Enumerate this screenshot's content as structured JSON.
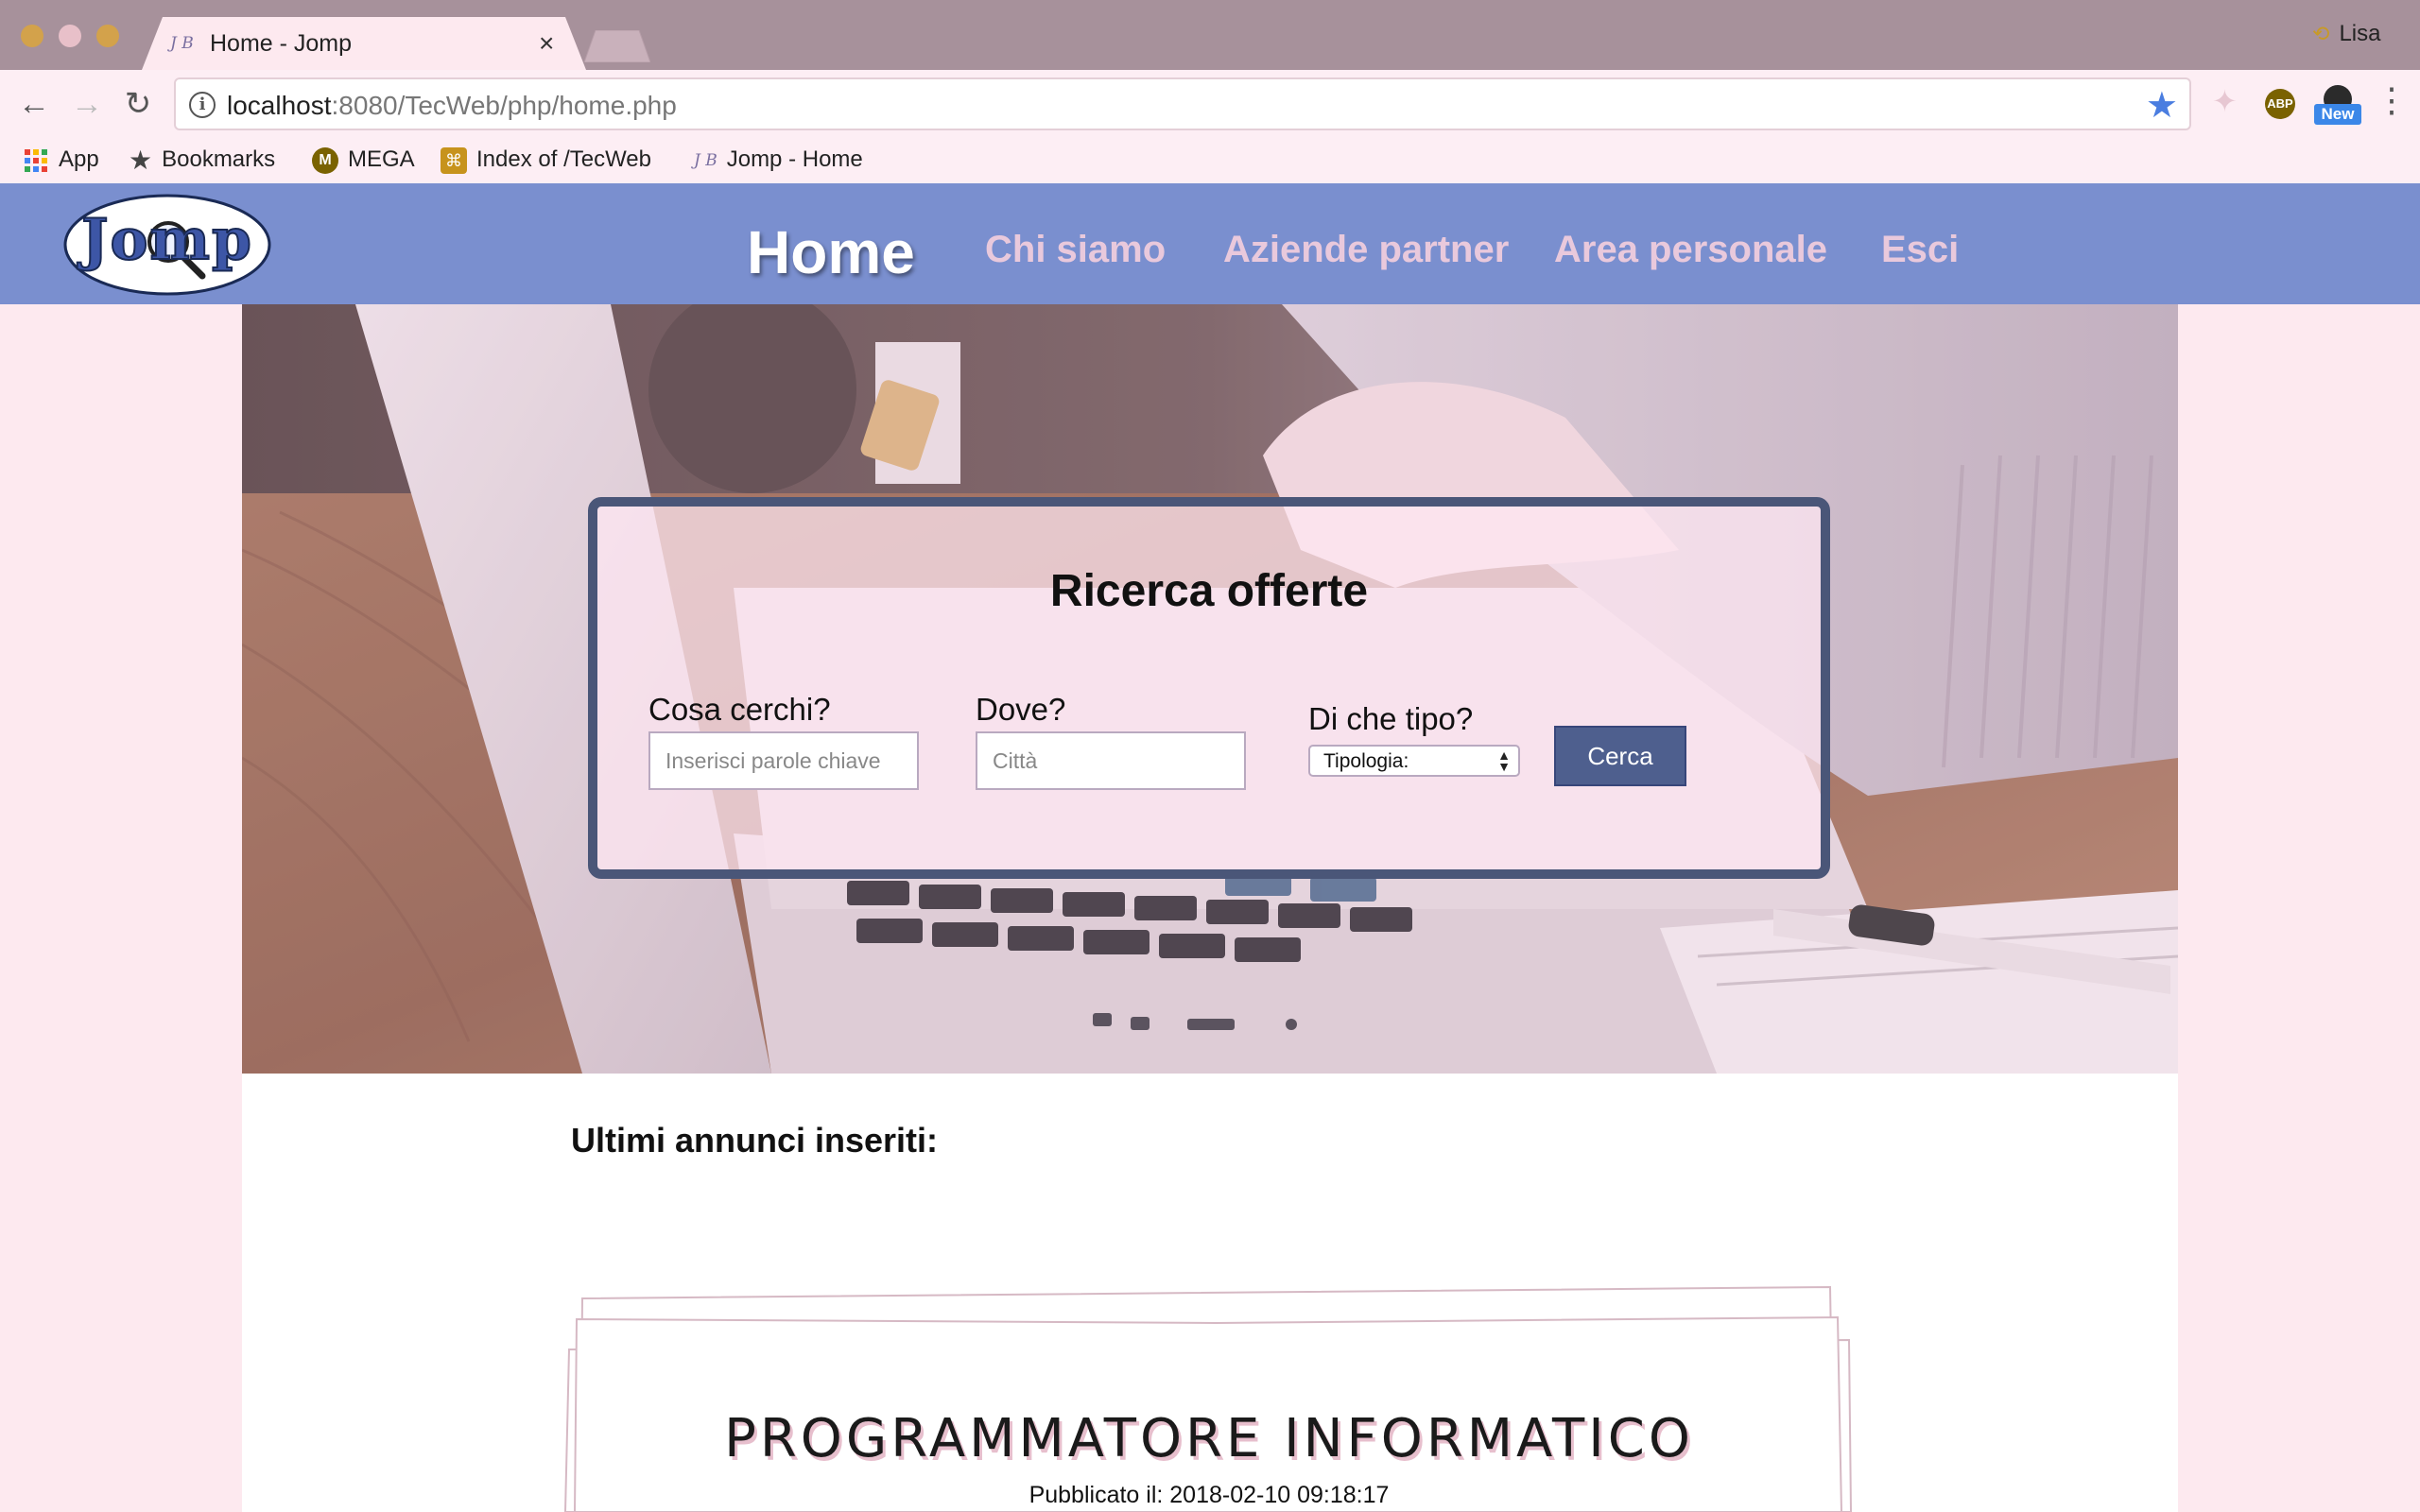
{
  "browser": {
    "tab": {
      "title": "Home - Jomp",
      "close_glyph": "×",
      "favicon": "J B"
    },
    "profile": {
      "name": "Lisa",
      "icon": "sync-icon"
    },
    "url": {
      "host": "localhost",
      "rest": ":8080/TecWeb/php/home.php"
    },
    "extensions": {
      "abp_label": "ABP",
      "new_badge": "New"
    },
    "bookmarks": [
      {
        "label": "App",
        "icon": "apps-grid-icon"
      },
      {
        "label": "Bookmarks",
        "icon": "star-icon"
      },
      {
        "label": "MEGA",
        "icon": "mega-icon",
        "glyph": "M"
      },
      {
        "label": "Index of /TecWeb",
        "icon": "xampp-icon"
      },
      {
        "label": "Jomp - Home",
        "icon": "jomp-favicon-icon",
        "glyph": "J B"
      }
    ]
  },
  "site": {
    "logo_text": "Jomp",
    "nav": [
      {
        "label": "Home",
        "active": true
      },
      {
        "label": "Chi siamo"
      },
      {
        "label": "Aziende partner"
      },
      {
        "label": "Area personale"
      },
      {
        "label": "Esci"
      }
    ],
    "search": {
      "title": "Ricerca offerte",
      "what_label": "Cosa cerchi?",
      "what_placeholder": "Inserisci parole chiave",
      "where_label": "Dove?",
      "where_placeholder": "Città",
      "type_label": "Di che tipo?",
      "type_selected": "Tipologia:",
      "button": "Cerca"
    },
    "latest_heading": "Ultimi annunci inseriti:",
    "listing": {
      "title": "PROGRAMMATORE INFORMATICO",
      "published": "Pubblicato il: 2018-02-10 09:18:17"
    }
  },
  "colors": {
    "header_bg": "#7a8fcf",
    "page_bg": "#fde9ef",
    "search_border": "#4a5678",
    "button_bg": "#4e5f8e",
    "titlebar": "#a7919b"
  }
}
